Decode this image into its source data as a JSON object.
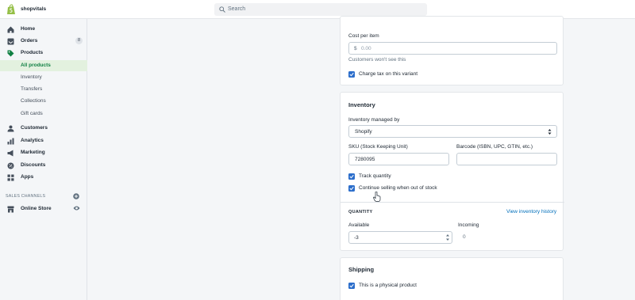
{
  "topbar": {
    "store_name": "shopvitals",
    "search_placeholder": "Search"
  },
  "sidebar": {
    "items": [
      {
        "label": "Home",
        "icon": "home-icon"
      },
      {
        "label": "Orders",
        "icon": "orders-icon",
        "badge": "8"
      },
      {
        "label": "Products",
        "icon": "tag-icon"
      },
      {
        "label": "Customers",
        "icon": "person-icon"
      },
      {
        "label": "Analytics",
        "icon": "bar-chart-icon"
      },
      {
        "label": "Marketing",
        "icon": "megaphone-icon"
      },
      {
        "label": "Discounts",
        "icon": "discount-icon"
      },
      {
        "label": "Apps",
        "icon": "apps-icon"
      }
    ],
    "product_subitems": [
      "All products",
      "Inventory",
      "Transfers",
      "Collections",
      "Gift cards"
    ],
    "sales_channels_label": "SALES CHANNELS",
    "online_store_label": "Online Store"
  },
  "pricing": {
    "cost_label": "Cost per item",
    "currency": "$",
    "cost_placeholder": "0.00",
    "cost_hint": "Customers won't see this",
    "charge_tax_label": "Charge tax on this variant"
  },
  "inventory": {
    "title": "Inventory",
    "managed_by_label": "Inventory managed by",
    "managed_by_value": "Shopify",
    "sku_label": "SKU (Stock Keeping Unit)",
    "sku_value": "7280095",
    "barcode_label": "Barcode (ISBN, UPC, GTIN, etc.)",
    "barcode_value": "",
    "track_quantity_label": "Track quantity",
    "continue_selling_label": "Continue selling when out of stock",
    "quantity_heading": "QUANTITY",
    "history_link": "View inventory history",
    "available_label": "Available",
    "available_value": "-3",
    "incoming_label": "Incoming",
    "incoming_value": "0"
  },
  "shipping": {
    "title": "Shipping",
    "physical_product_label": "This is a physical product"
  },
  "colors": {
    "brand_green": "#95bf47",
    "active_green": "#108043",
    "checkbox_blue": "#2c6ecb",
    "link_blue": "#006fbb"
  }
}
